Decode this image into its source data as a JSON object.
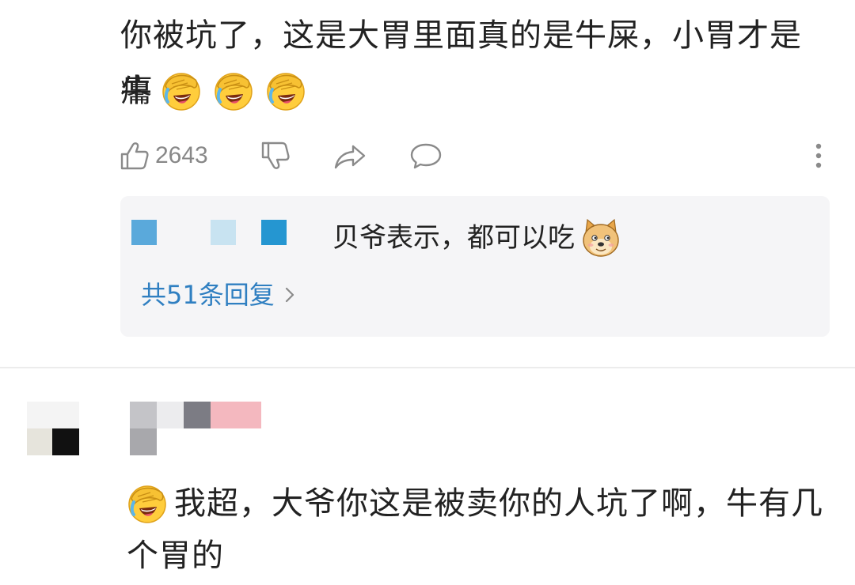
{
  "comment1": {
    "line1": "你被坑了，这是大胃里面真的是牛屎，小胃才是牛",
    "line2": "癟",
    "emoji_icons": [
      "facepalm-laugh-emoji",
      "facepalm-laugh-emoji",
      "facepalm-laugh-emoji"
    ],
    "actions": {
      "like_count": "2643"
    }
  },
  "reply_preview": {
    "text": "贝爷表示，都可以吃",
    "emoji_icon": "doge-emoji",
    "count_label": "共51条回复"
  },
  "comment2": {
    "emoji_icon": "facepalm-laugh-emoji",
    "line1": "我超，大爷你这是被卖你的人坑了啊，牛有几",
    "line2": "个胃的"
  },
  "colors": {
    "link": "#2f7fc1",
    "muted": "#888888",
    "reply_bg": "#f5f5f7",
    "divider": "#ececec"
  }
}
